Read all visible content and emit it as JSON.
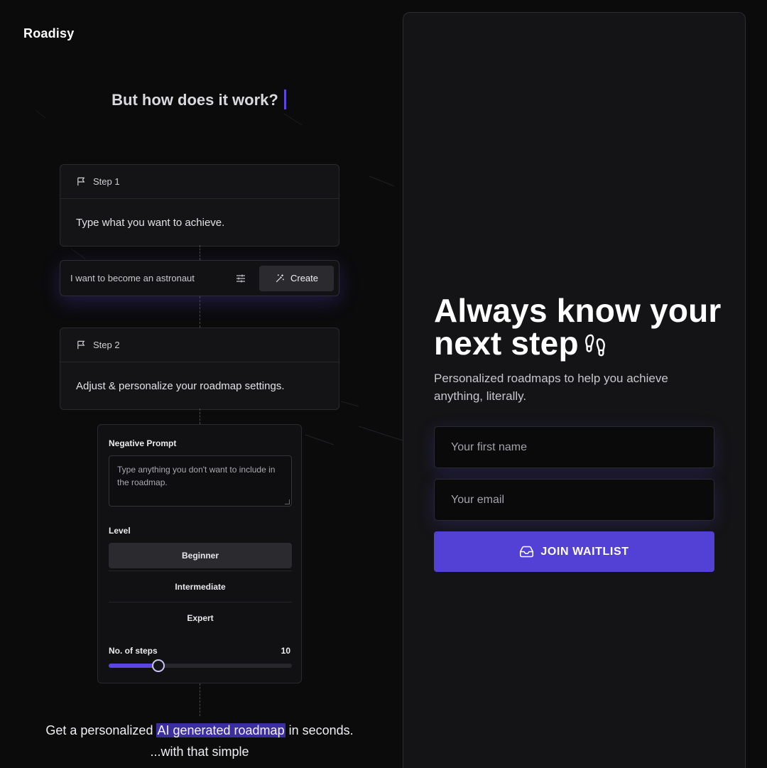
{
  "brand": {
    "name": "Roadisy"
  },
  "how": {
    "title": "But how does it work?"
  },
  "steps": [
    {
      "label": "Step 1",
      "text": "Type what you want to achieve."
    },
    {
      "label": "Step 2",
      "text": "Adjust & personalize your roadmap settings."
    }
  ],
  "prompt": {
    "value": "I want to become an astronaut",
    "create_label": "Create"
  },
  "settings": {
    "negative_label": "Negative Prompt",
    "negative_placeholder": "Type anything you don't want to include in the roadmap.",
    "level_label": "Level",
    "levels": [
      "Beginner",
      "Intermediate",
      "Expert"
    ],
    "selected_level": "Beginner",
    "steps_label": "No. of steps",
    "steps_value": "10",
    "steps_slider_fraction": 0.27
  },
  "bottom": {
    "pre": "Get a personalized ",
    "highlight": "AI generated roadmap",
    "post": " in seconds.",
    "partial_line": "...with that simple"
  },
  "hero": {
    "title_line1": "Always know your",
    "title_line2": "next step",
    "subtitle": "Personalized roadmaps to help you achieve anything, literally."
  },
  "form": {
    "first_name_placeholder": "Your first name",
    "email_placeholder": "Your email",
    "join_label": "JOIN WAITLIST"
  },
  "colors": {
    "accent": "#5341d6",
    "background": "#0b0b0c",
    "panel": "#141416"
  }
}
